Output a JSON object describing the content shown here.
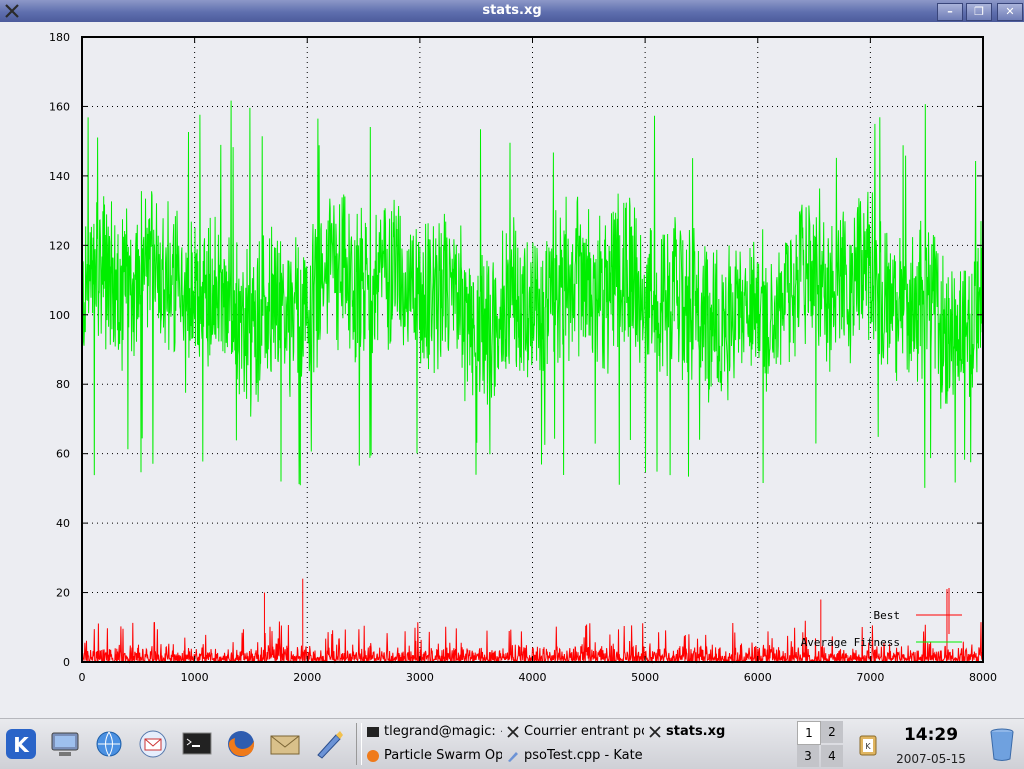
{
  "window": {
    "title": "stats.xg",
    "app_icon": "x-icon",
    "buttons": [
      {
        "name": "minimize-button",
        "label": "–"
      },
      {
        "name": "maximize-button",
        "label": "❐"
      },
      {
        "name": "close-button",
        "label": "✕"
      }
    ]
  },
  "chart_data": {
    "type": "line",
    "x_range": [
      0,
      8000
    ],
    "y_range": [
      0,
      180
    ],
    "x_ticks": [
      "0",
      "1000",
      "2000",
      "3000",
      "4000",
      "5000",
      "6000",
      "7000",
      "8000"
    ],
    "y_ticks": [
      "0",
      "20",
      "40",
      "60",
      "80",
      "100",
      "120",
      "140",
      "160",
      "180"
    ],
    "grid": true,
    "legend_placement": "bottom-right",
    "series": [
      {
        "name": "Best",
        "color": "#ff0000",
        "typical_range": [
          0,
          8
        ],
        "peak_values": [
          20,
          24,
          18,
          21
        ],
        "note_style": "spiky near zero"
      },
      {
        "name": "Average Fitness",
        "color": "#00ee00",
        "typical_range": [
          65,
          145
        ],
        "mean": 105,
        "max": 162,
        "min": 50
      }
    ]
  },
  "taskbar": {
    "launchers": [
      {
        "name": "kde-menu-icon"
      },
      {
        "name": "home-computer-icon"
      },
      {
        "name": "browser-globe-icon"
      },
      {
        "name": "kontact-mail-icon"
      },
      {
        "name": "terminal-icon"
      },
      {
        "name": "firefox-icon"
      },
      {
        "name": "mail-envelope-icon"
      },
      {
        "name": "kate-editor-icon"
      }
    ],
    "tasks": [
      {
        "label": "tlegrand@magic: ~/c",
        "icon": "terminal-small-icon",
        "active": false
      },
      {
        "label": "Courrier entrant po",
        "icon": "x-small-icon",
        "active": false
      },
      {
        "label": "stats.xg",
        "icon": "x-small-icon",
        "active": true
      },
      {
        "label": "Particle Swarm Opt",
        "icon": "firefox-small-icon",
        "active": false
      },
      {
        "label": "psoTest.cpp - Kate",
        "icon": "kate-small-icon",
        "active": false
      }
    ],
    "desktops": [
      "1",
      "2",
      "3",
      "4"
    ],
    "active_desktop": "1",
    "clock": {
      "time": "14:29",
      "date": "2007-05-15"
    }
  }
}
